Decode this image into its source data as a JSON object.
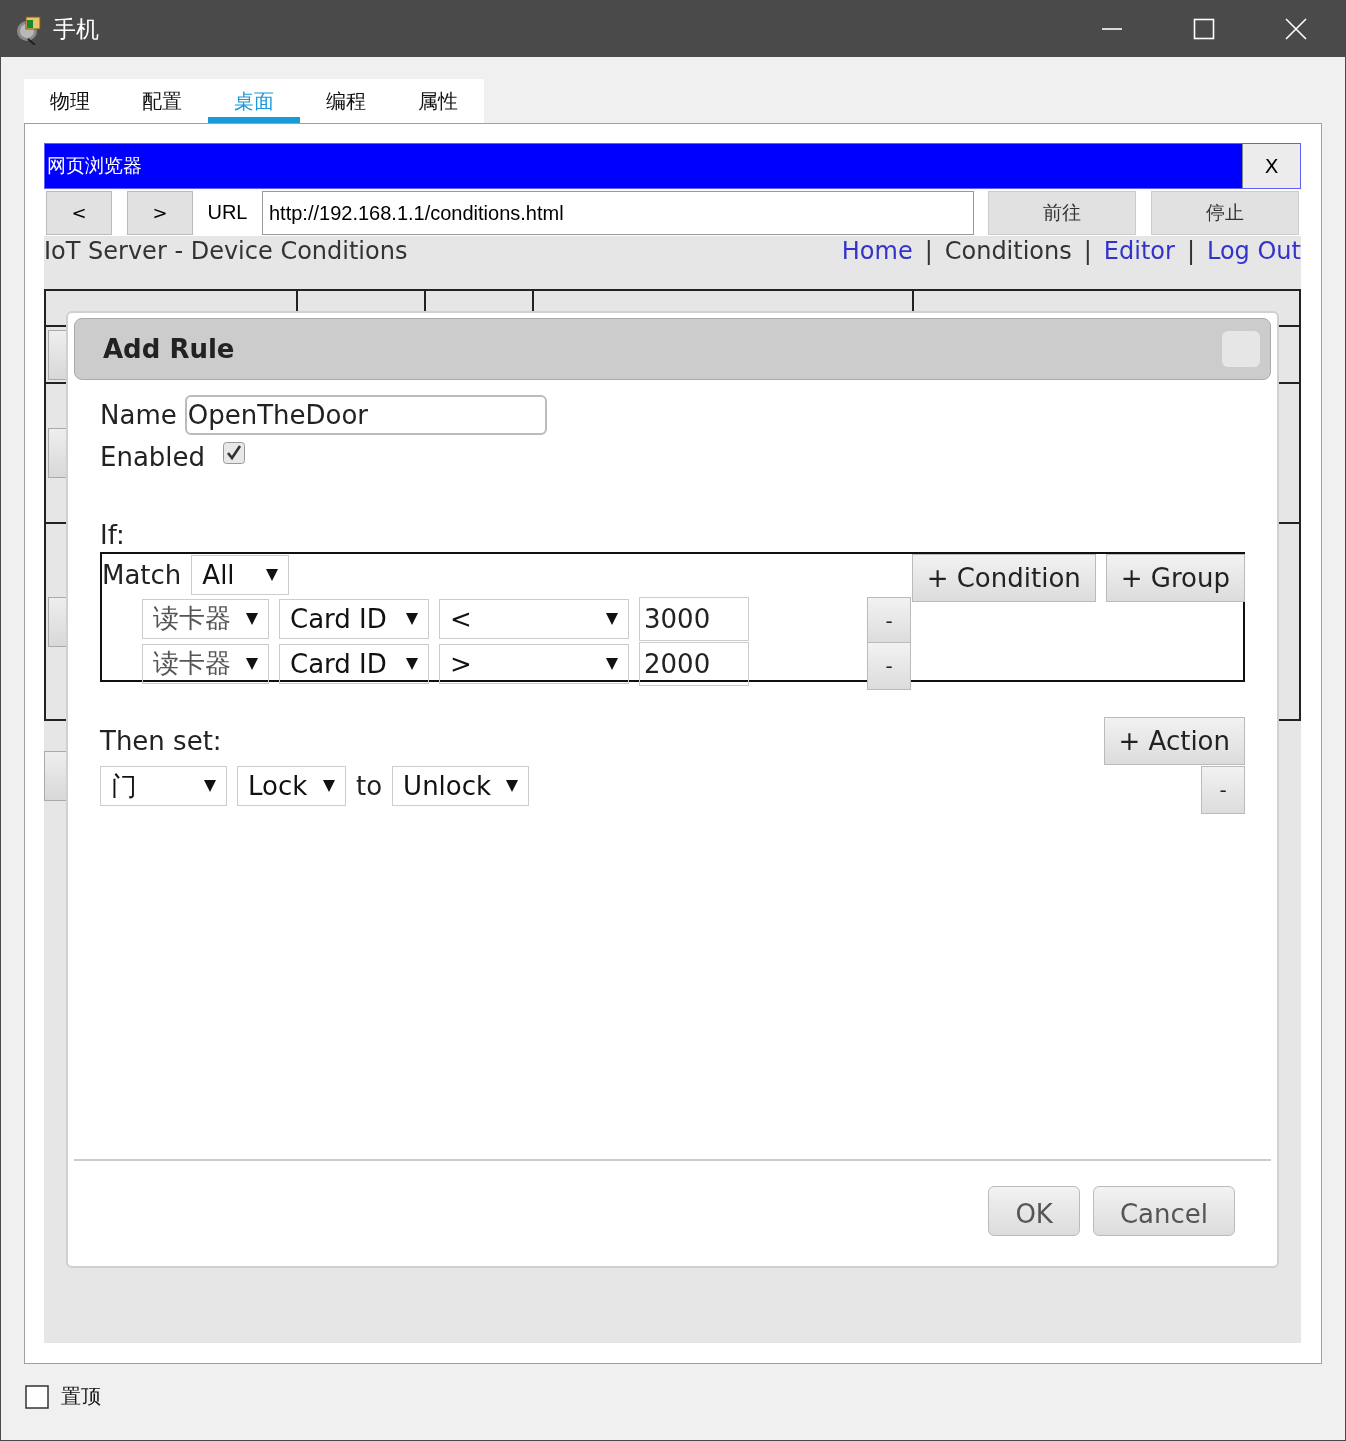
{
  "window": {
    "title": "手机"
  },
  "tabs": [
    {
      "label": "物理",
      "selected": false
    },
    {
      "label": "配置",
      "selected": false
    },
    {
      "label": "桌面",
      "selected": true
    },
    {
      "label": "编程",
      "selected": false
    },
    {
      "label": "属性",
      "selected": false
    }
  ],
  "browser": {
    "title": "网页浏览器",
    "close": "X",
    "back": "<",
    "forward": ">",
    "url_label": "URL",
    "url": "http://192.168.1.1/conditions.html",
    "go": "前往",
    "stop": "停止"
  },
  "page": {
    "heading": "IoT Server - Device Conditions",
    "nav": [
      {
        "kind": "link",
        "label": "Home"
      },
      {
        "kind": "separator",
        "label": "|"
      },
      {
        "kind": "current",
        "label": "Conditions"
      },
      {
        "kind": "separator",
        "label": "|"
      },
      {
        "kind": "link",
        "label": "Editor"
      },
      {
        "kind": "separator",
        "label": "|"
      },
      {
        "kind": "link",
        "label": "Log Out"
      }
    ]
  },
  "dialog": {
    "title": "Add Rule",
    "name_label": "Name",
    "name_value": "OpenTheDoor",
    "enabled_label": "Enabled",
    "enabled": true,
    "if_label": "If:",
    "match_label": "Match",
    "match": "All",
    "add_condition": "+ Condition",
    "add_group": "+ Group",
    "conditions": [
      {
        "device": "读卡器",
        "property": "Card ID",
        "operator": "<",
        "value": "3000",
        "remove": "-"
      },
      {
        "device": "读卡器",
        "property": "Card ID",
        "operator": ">",
        "value": "2000",
        "remove": "-"
      }
    ],
    "then_label": "Then set:",
    "add_action": "+ Action",
    "actions": [
      {
        "device": "门",
        "property": "Lock",
        "to": "to",
        "value": "Unlock",
        "remove": "-"
      }
    ],
    "buttons": [
      "OK",
      "Cancel"
    ]
  },
  "always_on_top": {
    "label": "置顶",
    "checked": false
  }
}
